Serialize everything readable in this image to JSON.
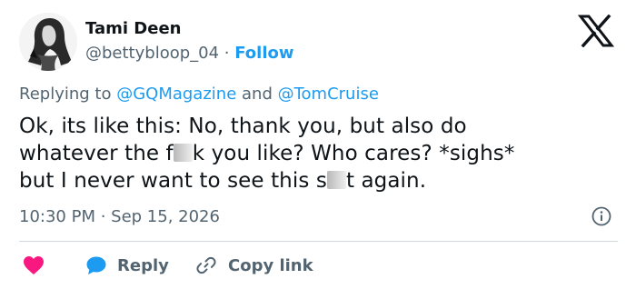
{
  "author": {
    "display_name": "Tami Deen",
    "handle": "@bettybloop_04",
    "separator": " · ",
    "follow_label": "Follow"
  },
  "reply_context": {
    "prefix": "Replying to ",
    "mention_1": "@GQMagazine",
    "conjunction": " and ",
    "mention_2": "@TomCruise"
  },
  "tweet": {
    "line1": "Ok, its like this: No, thank you, but also do",
    "line2_a": "whatever the f",
    "line2_b": "k you like? Who cares? *sighs*",
    "line3_a": "but I never want to see this s",
    "line3_b": "t again."
  },
  "meta": {
    "time": "10:30 PM",
    "separator": " · ",
    "date": "Sep 15, 2026"
  },
  "actions": {
    "reply_label": "Reply",
    "copy_label": "Copy link"
  },
  "icons": {
    "logo": "x-logo-icon",
    "info": "info-icon",
    "like": "heart-icon",
    "reply": "reply-bubble-icon",
    "copy": "link-icon"
  },
  "colors": {
    "text": "#0f1419",
    "secondary": "#536471",
    "accent": "#1d9bf0",
    "like": "#f91880",
    "divider": "#cfd9de"
  }
}
